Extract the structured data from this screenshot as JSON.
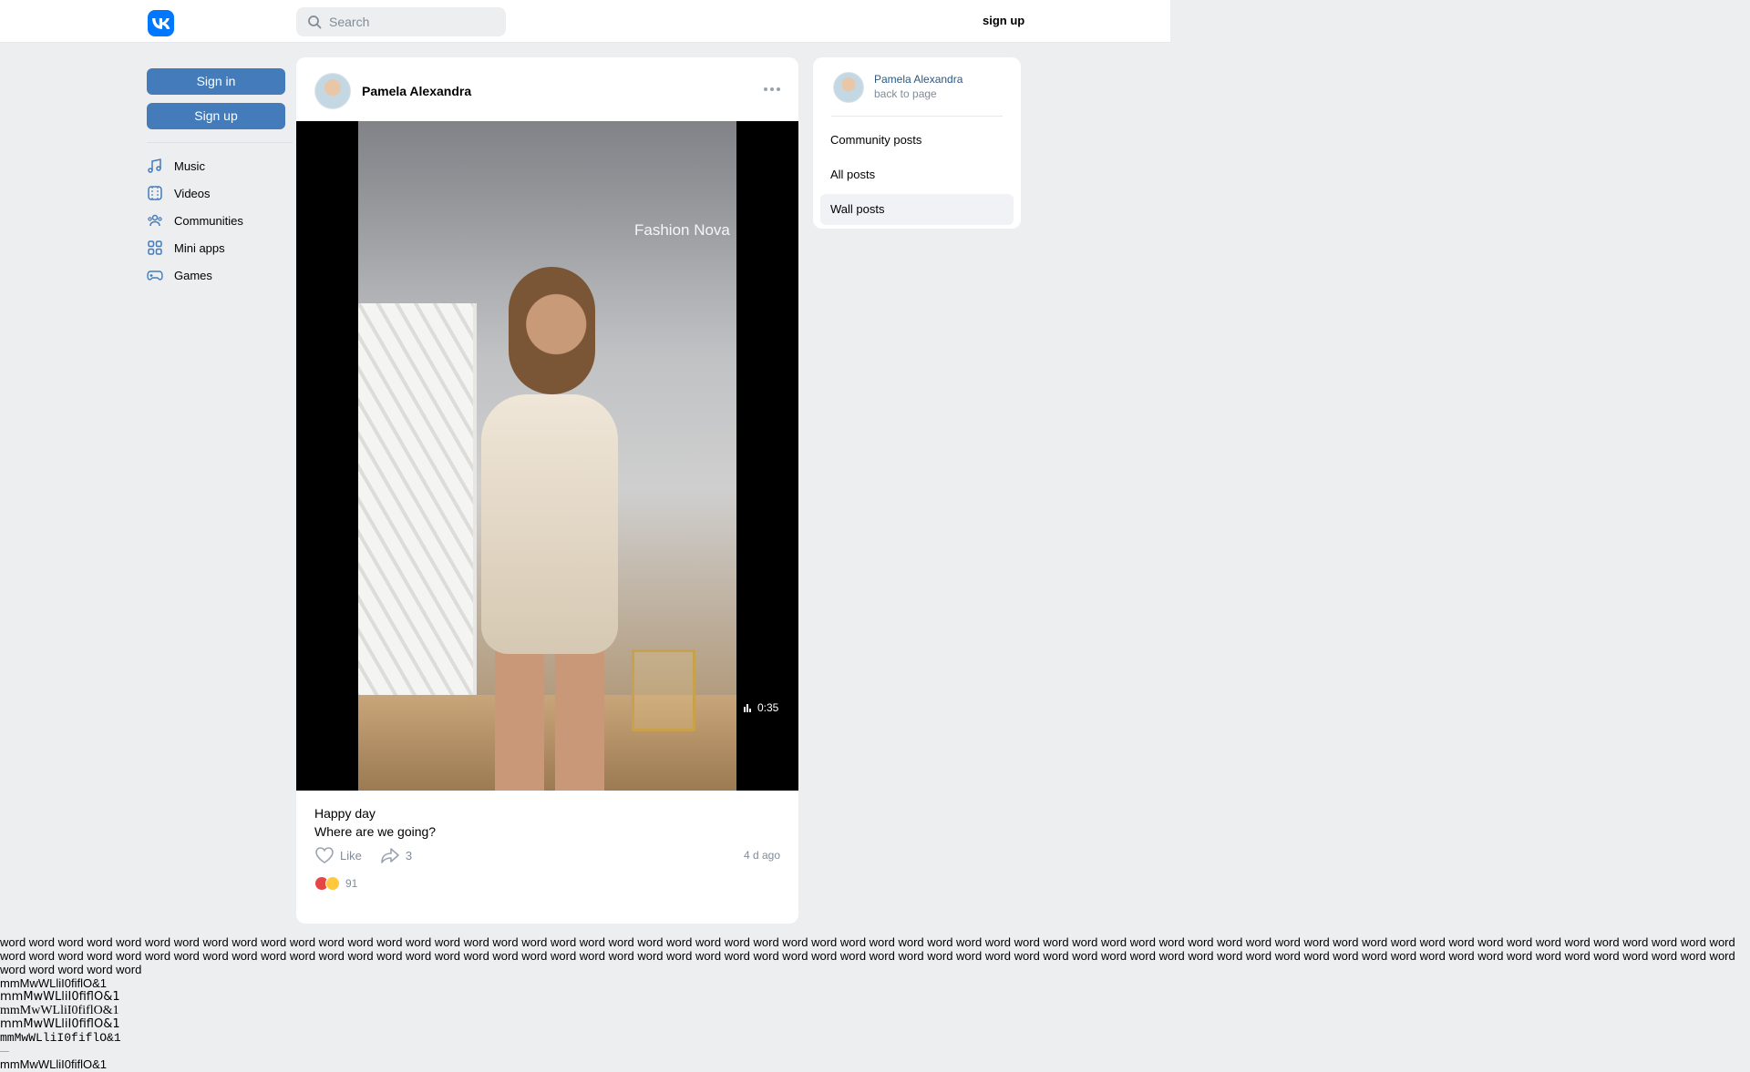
{
  "header": {
    "search_placeholder": "Search",
    "signup_label": "sign up"
  },
  "left": {
    "signin_label": "Sign in",
    "signup_label": "Sign up",
    "nav": [
      {
        "label": "Music",
        "icon": "music-icon"
      },
      {
        "label": "Videos",
        "icon": "video-icon"
      },
      {
        "label": "Communities",
        "icon": "communities-icon"
      },
      {
        "label": "Mini apps",
        "icon": "mini-apps-icon"
      },
      {
        "label": "Games",
        "icon": "gamepad-icon"
      }
    ]
  },
  "post": {
    "author": "Pamela Alexandra",
    "watermark": "Fashion Nova",
    "duration": "0:35",
    "caption_line1": "Happy day",
    "caption_line2": "Where are we going?",
    "like_label": "Like",
    "share_count": "3",
    "time_ago": "4 d ago",
    "reactions_count": "91"
  },
  "right": {
    "profile_name": "Pamela Alexandra",
    "back_label": "back to page",
    "menu": [
      "Community posts",
      "All posts",
      "Wall posts"
    ],
    "active_item": "Wall posts"
  },
  "test_text": {
    "words": "word word word word word word word word word word word word word word word word word word word word word word word word word word word word word word word word word word word word word word word word word word word word word word word word word word word word word word word word word word word word word word word word word word word word word word word word word word word word word word word word word word word word word word word word word word word word word word word word word word word word word word word word word word word word word word word word word word word word word word word word word word word word word",
    "lines": [
      "mmMwWLliI0fiflO&1",
      "mmMwWLliI0fiflO&1",
      "mmMwWLliI0fiflO&1",
      "mmMwWLliI0fiflO&1",
      "mmMwWLliI0fiflO&1",
      "mmMwWLliI0fiflO&1"
    ]
  },
  "colors": {
    "brand": "#0077ff",
    "button": "#447bba",
    "link": "#2a5885",
    "muted": "#818c99",
    "page_bg": "#edeef0"
  }
}
